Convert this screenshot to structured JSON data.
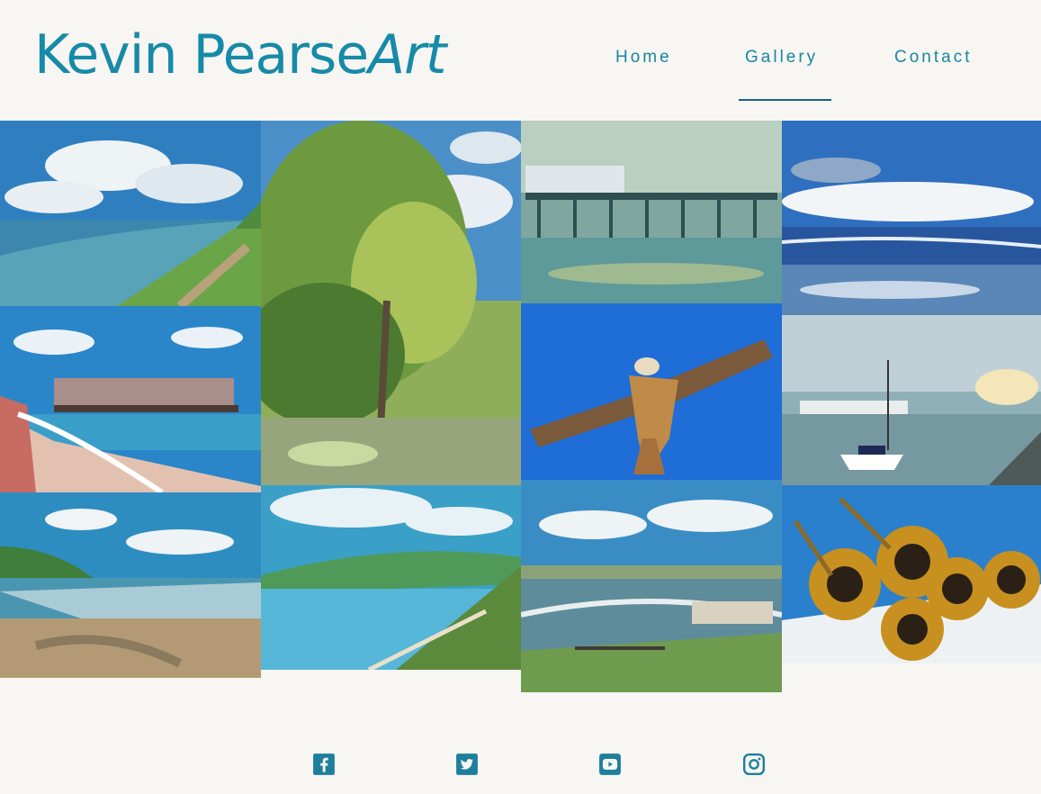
{
  "brand": {
    "name_regular": "Kevin Pearse",
    "name_italic": "Art"
  },
  "nav": {
    "items": [
      {
        "label": "Home"
      },
      {
        "label": "Gallery",
        "active": true
      },
      {
        "label": "Contact"
      }
    ]
  },
  "colors": {
    "brand": "#168aa8",
    "background": "#f7f6f2",
    "icon": "#1e7f9c"
  },
  "gallery": {
    "paintings": [
      {
        "subject": "coastal cliff path"
      },
      {
        "subject": "trees and sea view"
      },
      {
        "subject": "old pier"
      },
      {
        "subject": "sea and clouds"
      },
      {
        "subject": "pier from promenade"
      },
      {
        "subject": "red kite"
      },
      {
        "subject": "harbour with boats"
      },
      {
        "subject": "beach and cliffs"
      },
      {
        "subject": "bay view from cliff"
      },
      {
        "subject": "shoreline with groynes"
      },
      {
        "subject": "sunflowers"
      }
    ]
  },
  "social": [
    "facebook-icon",
    "twitter-icon",
    "youtube-icon",
    "instagram-icon"
  ]
}
